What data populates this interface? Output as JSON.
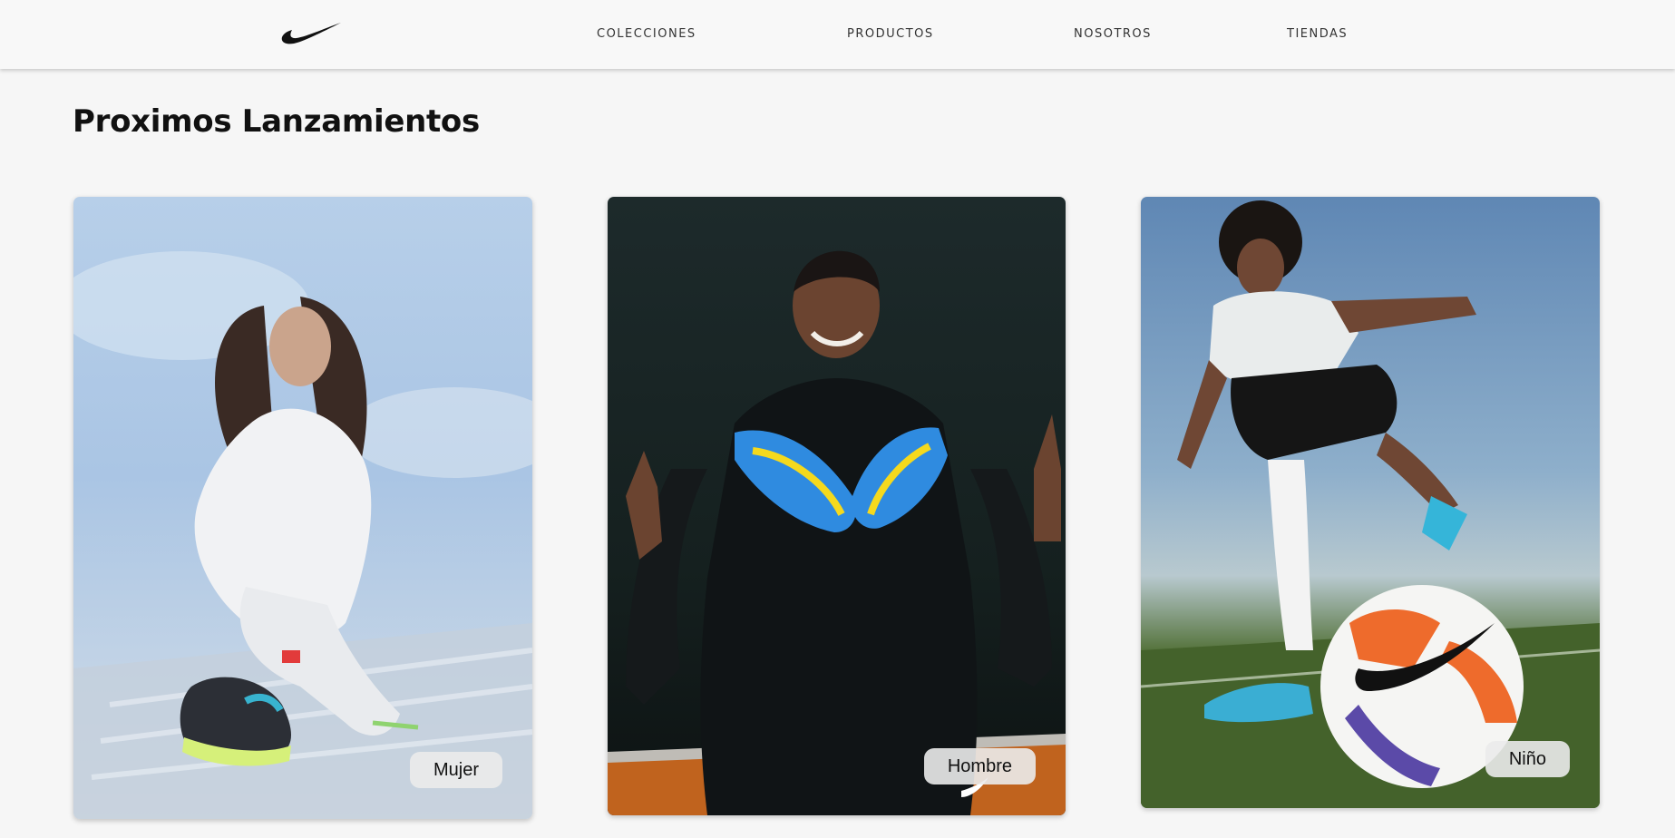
{
  "header": {
    "logo_icon": "nike-swoosh-icon",
    "nav": [
      {
        "label": "colecciones"
      },
      {
        "label": "productos"
      },
      {
        "label": "nosotros"
      },
      {
        "label": "tiendas"
      }
    ]
  },
  "main": {
    "title": "Proximos Lanzamientos",
    "cards": [
      {
        "label": "Mujer"
      },
      {
        "label": "Hombre"
      },
      {
        "label": "Niño"
      }
    ]
  },
  "colors": {
    "background": "#f6f6f6",
    "header_background": "#f8f8f8",
    "text": "#111111",
    "label_background": "#ebebeb"
  }
}
